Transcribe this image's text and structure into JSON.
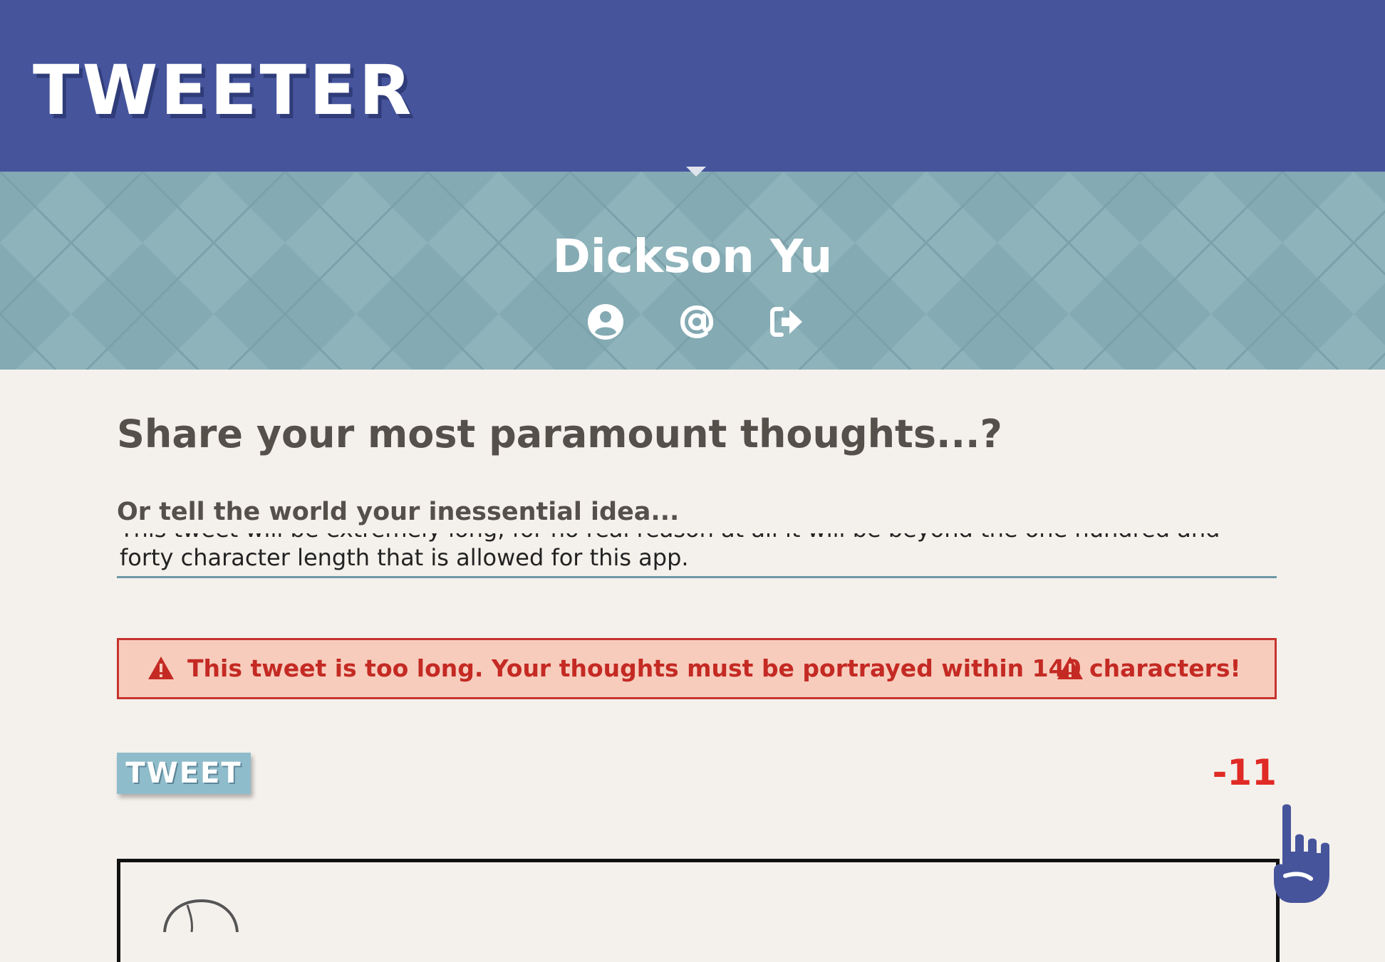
{
  "header": {
    "brand": "TWEETER",
    "brand_color": "#46549c"
  },
  "profile": {
    "name": "Dickson Yu",
    "background_color": "#84aab3",
    "icons": [
      "user-circle-icon",
      "at-sign-icon",
      "sign-out-icon"
    ]
  },
  "compose": {
    "headline": "Share your most paramount thoughts...?",
    "sublabel": "Or tell the world your inessential idea...",
    "tweet_text": "This tweet will be extremely long, for no real reason at all it will be beyond the one hundred and forty character length that is allowed for this app.",
    "error_message": "This tweet is too long. Your thoughts must be portrayed within 140 characters!",
    "error_color": "#c42a23",
    "tweet_button_label": "TWEET",
    "char_count": "-11"
  },
  "cursor": {
    "icon": "pointing-hand-icon"
  }
}
